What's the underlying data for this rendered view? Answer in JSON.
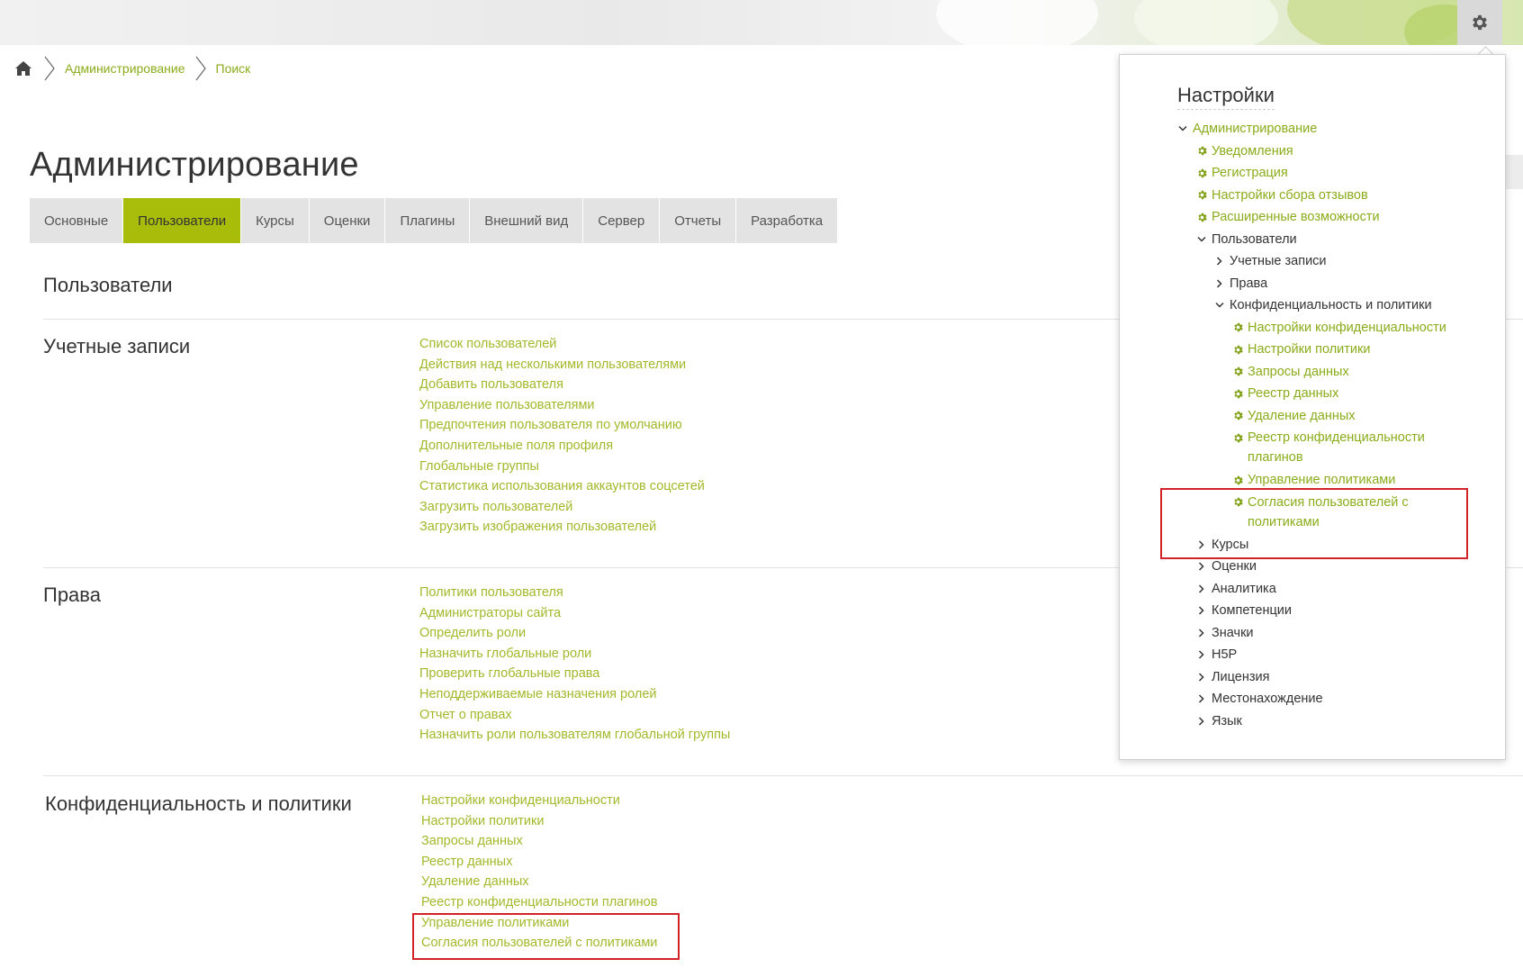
{
  "breadcrumb": {
    "home_icon": "home-icon",
    "items": [
      "Администрирование",
      "Поиск"
    ]
  },
  "page_title": "Администрирование",
  "tabs": [
    {
      "label": "Основные",
      "active": false
    },
    {
      "label": "Пользователи",
      "active": true
    },
    {
      "label": "Курсы",
      "active": false
    },
    {
      "label": "Оценки",
      "active": false
    },
    {
      "label": "Плагины",
      "active": false
    },
    {
      "label": "Внешний вид",
      "active": false
    },
    {
      "label": "Сервер",
      "active": false
    },
    {
      "label": "Отчеты",
      "active": false
    },
    {
      "label": "Разработка",
      "active": false
    }
  ],
  "section_heading": "Пользователи",
  "sections": [
    {
      "title": "Учетные записи",
      "links": [
        "Список пользователей",
        "Действия над несколькими пользователями",
        "Добавить пользователя",
        "Управление пользователями",
        "Предпочтения пользователя по умолчанию",
        "Дополнительные поля профиля",
        "Глобальные группы",
        "Статистика использования аккаунтов соцсетей",
        "Загрузить пользователей",
        "Загрузить изображения пользователей"
      ]
    },
    {
      "title": "Права",
      "links": [
        "Политики пользователя",
        "Администраторы сайта",
        "Определить роли",
        "Назначить глобальные роли",
        "Проверить глобальные права",
        "Неподдерживаемые назначения ролей",
        "Отчет о правах",
        "Назначить роли пользователям глобальной группы"
      ]
    },
    {
      "title": "Конфиденциальность и политики",
      "links": [
        "Настройки конфиденциальности",
        "Настройки политики",
        "Запросы данных",
        "Реестр данных",
        "Удаление данных",
        "Реестр конфиденциальности плагинов",
        "Управление политиками",
        "Согласия пользователей с политиками"
      ]
    }
  ],
  "settings_panel": {
    "title": "Настройки",
    "tree": [
      {
        "label": "Администрирование",
        "type": "expanded",
        "level": 0,
        "link": true
      },
      {
        "label": "Уведомления",
        "type": "setting",
        "level": 1,
        "link": true
      },
      {
        "label": "Регистрация",
        "type": "setting",
        "level": 1,
        "link": true
      },
      {
        "label": "Настройки сбора отзывов",
        "type": "setting",
        "level": 1,
        "link": true
      },
      {
        "label": "Расширенные возможности",
        "type": "setting",
        "level": 1,
        "link": true
      },
      {
        "label": "Пользователи",
        "type": "expanded",
        "level": 1,
        "link": false
      },
      {
        "label": "Учетные записи",
        "type": "collapsed",
        "level": 2,
        "link": false
      },
      {
        "label": "Права",
        "type": "collapsed",
        "level": 2,
        "link": false
      },
      {
        "label": "Конфиденциальность и политики",
        "type": "expanded",
        "level": 2,
        "link": false
      },
      {
        "label": "Настройки конфиденциальности",
        "type": "setting",
        "level": 3,
        "link": true
      },
      {
        "label": "Настройки политики",
        "type": "setting",
        "level": 3,
        "link": true
      },
      {
        "label": "Запросы данных",
        "type": "setting",
        "level": 3,
        "link": true
      },
      {
        "label": "Реестр данных",
        "type": "setting",
        "level": 3,
        "link": true
      },
      {
        "label": "Удаление данных",
        "type": "setting",
        "level": 3,
        "link": true
      },
      {
        "label": "Реестр конфиденциальности плагинов",
        "type": "setting",
        "level": 3,
        "link": true
      },
      {
        "label": "Управление политиками",
        "type": "setting",
        "level": 3,
        "link": true
      },
      {
        "label": "Согласия пользователей с политиками",
        "type": "setting",
        "level": 3,
        "link": true
      },
      {
        "label": "Курсы",
        "type": "collapsed",
        "level": 1,
        "link": false
      },
      {
        "label": "Оценки",
        "type": "collapsed",
        "level": 1,
        "link": false
      },
      {
        "label": "Аналитика",
        "type": "collapsed",
        "level": 1,
        "link": false
      },
      {
        "label": "Компетенции",
        "type": "collapsed",
        "level": 1,
        "link": false
      },
      {
        "label": "Значки",
        "type": "collapsed",
        "level": 1,
        "link": false
      },
      {
        "label": "H5P",
        "type": "collapsed",
        "level": 1,
        "link": false
      },
      {
        "label": "Лицензия",
        "type": "collapsed",
        "level": 1,
        "link": false
      },
      {
        "label": "Местонахождение",
        "type": "collapsed",
        "level": 1,
        "link": false
      },
      {
        "label": "Язык",
        "type": "collapsed",
        "level": 1,
        "link": false
      }
    ]
  },
  "colors": {
    "accent": "#a8bd0a",
    "link": "#a3b82a",
    "highlight_box": "#d2232a"
  },
  "icons": {
    "settings": "gear-icon",
    "setting_item": "gear-icon",
    "expanded": "chevron-down-icon",
    "collapsed": "chevron-right-icon"
  }
}
